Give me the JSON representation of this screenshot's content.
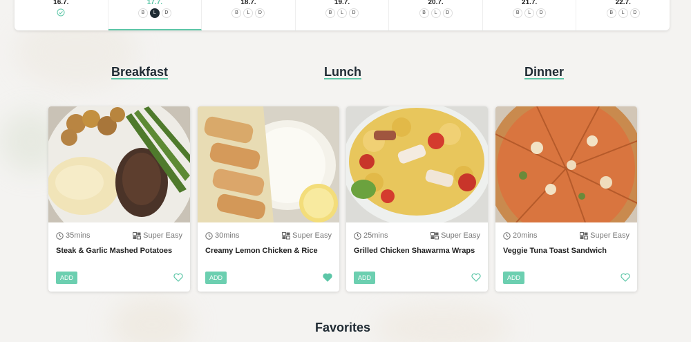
{
  "days": [
    {
      "date": "16.7.",
      "done": true,
      "meals": []
    },
    {
      "date": "17.7.",
      "active": true,
      "meals": [
        "B",
        "L",
        "D"
      ],
      "selected": "L"
    },
    {
      "date": "18.7.",
      "meals": [
        "B",
        "L",
        "D"
      ]
    },
    {
      "date": "19.7.",
      "meals": [
        "B",
        "L",
        "D"
      ]
    },
    {
      "date": "20.7.",
      "meals": [
        "B",
        "L",
        "D"
      ]
    },
    {
      "date": "21.7.",
      "meals": [
        "B",
        "L",
        "D"
      ]
    },
    {
      "date": "22.7.",
      "meals": [
        "B",
        "L",
        "D"
      ]
    }
  ],
  "sections": {
    "breakfast": "Breakfast",
    "lunch": "Lunch",
    "dinner": "Dinner",
    "favorites": "Favorites"
  },
  "cards": [
    {
      "time": "35mins",
      "difficulty": "Super Easy",
      "title": "Steak & Garlic Mashed Potatoes",
      "add": "ADD",
      "favorited": false
    },
    {
      "time": "30mins",
      "difficulty": "Super Easy",
      "title": "Creamy Lemon Chicken & Rice",
      "add": "ADD",
      "favorited": true
    },
    {
      "time": "25mins",
      "difficulty": "Super Easy",
      "title": "Grilled Chicken Shawarma Wraps",
      "add": "ADD",
      "favorited": false
    },
    {
      "time": "20mins",
      "difficulty": "Super Easy",
      "title": "Veggie Tuna Toast Sandwich",
      "add": "ADD",
      "favorited": false
    }
  ],
  "colors": {
    "accent": "#5cc6a7",
    "dark": "#1e2b33"
  }
}
